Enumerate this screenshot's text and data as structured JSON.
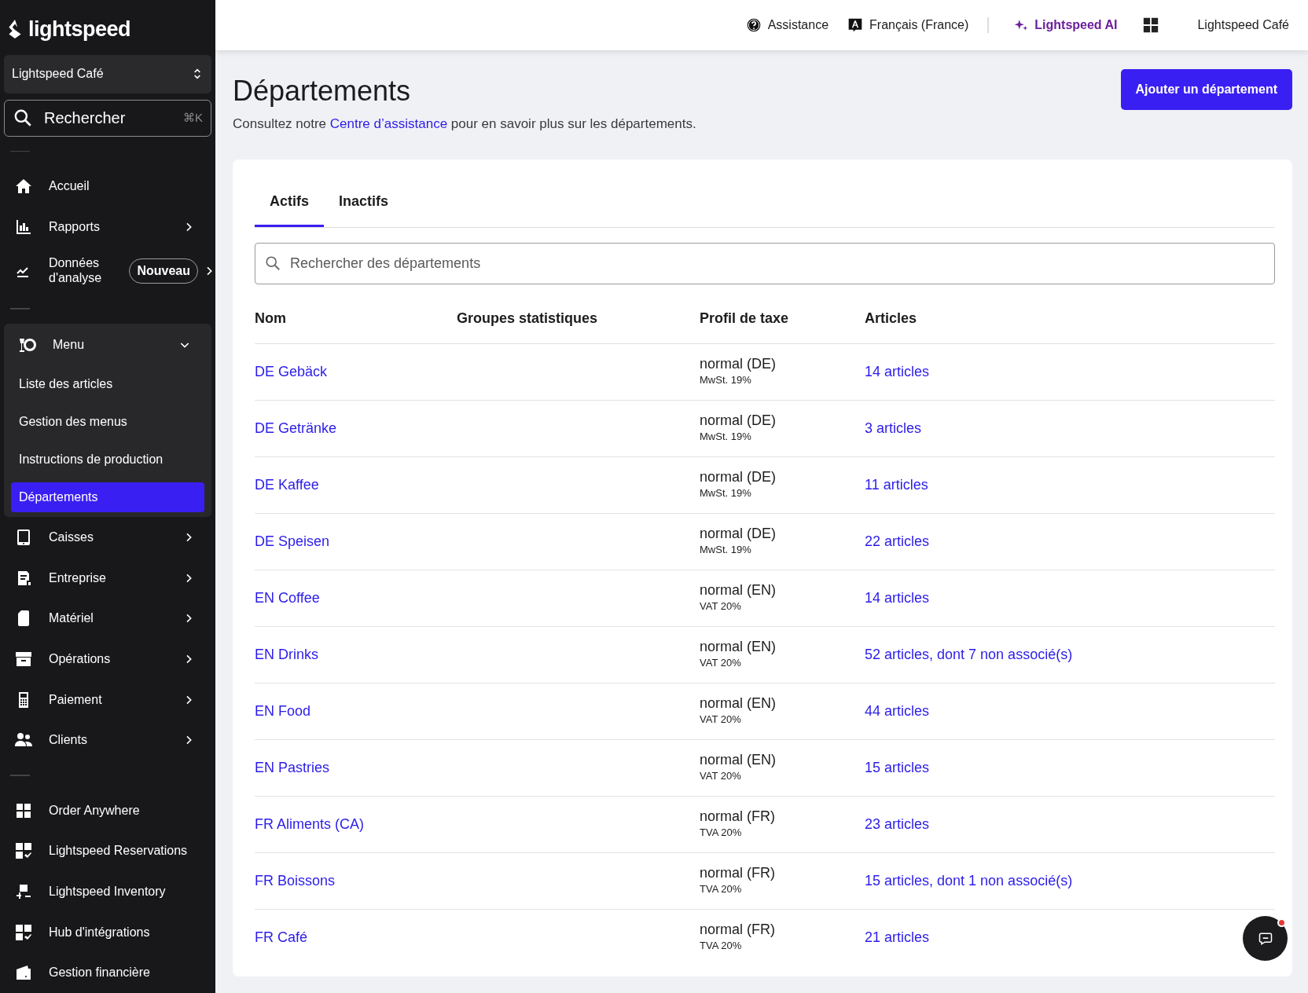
{
  "sidebar": {
    "logo": "lightspeed",
    "location": "Lightspeed Café",
    "search": {
      "placeholder": "Rechercher",
      "shortcut": "⌘K"
    },
    "sections": [
      [
        {
          "label": "Accueil",
          "submenu": false
        },
        {
          "label": "Rapports",
          "submenu": true
        },
        {
          "label": "Données d'analyse",
          "badge": "Nouveau",
          "submenu": true
        }
      ],
      [
        {
          "label": "Menu",
          "submenu": true,
          "expanded": true,
          "children": [
            {
              "label": "Liste des articles",
              "selected": false
            },
            {
              "label": "Gestion des menus",
              "selected": false
            },
            {
              "label": "Instructions de production",
              "selected": false
            },
            {
              "label": "Départements",
              "selected": true
            }
          ]
        },
        {
          "label": "Caisses",
          "submenu": true
        },
        {
          "label": "Entreprise",
          "submenu": true
        },
        {
          "label": "Matériel",
          "submenu": true
        },
        {
          "label": "Opérations",
          "submenu": true
        },
        {
          "label": "Paiement",
          "submenu": true
        },
        {
          "label": "Clients",
          "submenu": true
        }
      ],
      [
        {
          "label": "Order Anywhere",
          "submenu": false
        },
        {
          "label": "Lightspeed Reservations",
          "submenu": false
        },
        {
          "label": "Lightspeed Inventory",
          "submenu": false
        },
        {
          "label": "Hub d'intégrations",
          "submenu": false
        },
        {
          "label": "Gestion financière",
          "submenu": false
        }
      ]
    ]
  },
  "topbar": {
    "assistance": "Assistance",
    "language": "Français (France)",
    "ai": "Lightspeed AI",
    "account": "Lightspeed Café"
  },
  "page": {
    "title": "Départements",
    "add_button": "Ajouter un département",
    "help_before": "Consultez notre",
    "help_link": "Centre d’assistance",
    "help_after": "pour en savoir plus sur les départements."
  },
  "tabs": [
    {
      "label": "Actifs",
      "selected": true
    },
    {
      "label": "Inactifs",
      "selected": false
    }
  ],
  "search": {
    "placeholder": "Rechercher des départements"
  },
  "table": {
    "columns": [
      "Nom",
      "Groupes statistiques",
      "Profil de taxe",
      "Articles"
    ],
    "rows": [
      {
        "name": "DE Gebäck",
        "tax_profile": "normal (DE)",
        "tax_rate": "MwSt. 19%",
        "articles": "14 articles"
      },
      {
        "name": "DE Getränke",
        "tax_profile": "normal (DE)",
        "tax_rate": "MwSt. 19%",
        "articles": "3 articles"
      },
      {
        "name": "DE Kaffee",
        "tax_profile": "normal (DE)",
        "tax_rate": "MwSt. 19%",
        "articles": "11 articles"
      },
      {
        "name": "DE Speisen",
        "tax_profile": "normal (DE)",
        "tax_rate": "MwSt. 19%",
        "articles": "22 articles"
      },
      {
        "name": "EN Coffee",
        "tax_profile": "normal (EN)",
        "tax_rate": "VAT 20%",
        "articles": "14 articles"
      },
      {
        "name": "EN Drinks",
        "tax_profile": "normal (EN)",
        "tax_rate": "VAT 20%",
        "articles": "52 articles, dont 7 non associé(s)"
      },
      {
        "name": "EN Food",
        "tax_profile": "normal (EN)",
        "tax_rate": "VAT 20%",
        "articles": "44 articles"
      },
      {
        "name": "EN Pastries",
        "tax_profile": "normal (EN)",
        "tax_rate": "VAT 20%",
        "articles": "15 articles"
      },
      {
        "name": "FR Aliments (CA)",
        "tax_profile": "normal (FR)",
        "tax_rate": "TVA 20%",
        "articles": "23 articles"
      },
      {
        "name": "FR Boissons",
        "tax_profile": "normal (FR)",
        "tax_rate": "TVA 20%",
        "articles": "15 articles, dont 1 non associé(s)"
      },
      {
        "name": "FR Café",
        "tax_profile": "normal (FR)",
        "tax_rate": "TVA 20%",
        "articles": "21 articles"
      }
    ]
  },
  "chat": {
    "unread": true
  }
}
